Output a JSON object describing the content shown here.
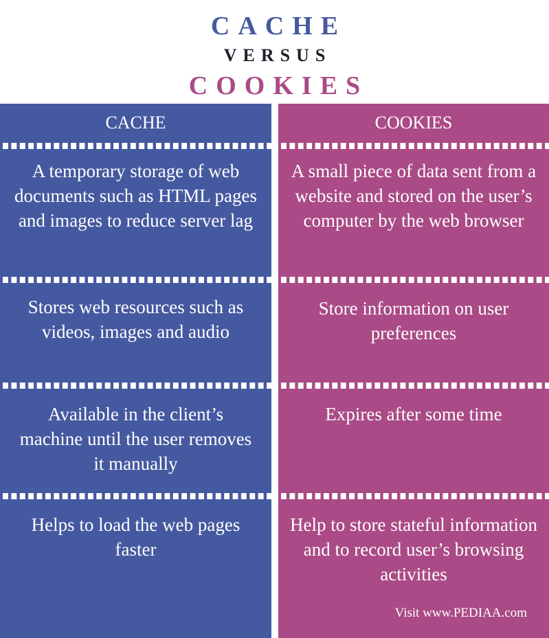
{
  "title": {
    "line1": "CACHE",
    "line2": "VERSUS",
    "line3": "COOKIES"
  },
  "colors": {
    "cache": "#4559a0",
    "cookies": "#aa4a86",
    "versus": "#1f1f2b"
  },
  "left": {
    "header": "CACHE",
    "rows": [
      "A temporary storage of web documents such as HTML pages and images to reduce server lag",
      "Stores web resources such as videos, images and audio",
      "Available in the client’s machine until the user removes it manually",
      "Helps to load the web pages faster"
    ]
  },
  "right": {
    "header": "COOKIES",
    "rows": [
      "A small piece of data sent from a website and stored on the user’s computer by the web browser",
      "Store information on user preferences",
      "Expires after some time",
      "Help to store stateful information and to record user’s browsing activities"
    ]
  },
  "footer": {
    "credit": "Visit www.PEDIAA.com"
  }
}
